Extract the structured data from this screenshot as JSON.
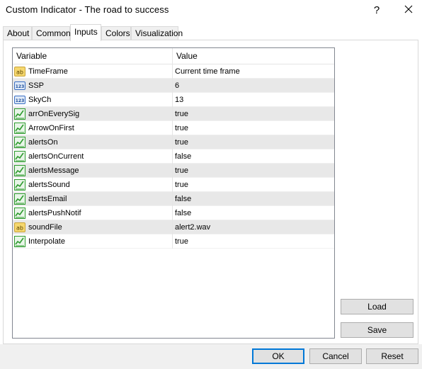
{
  "window": {
    "title": "Custom Indicator - The road to success",
    "help_glyph": "?",
    "close_glyph": "✕"
  },
  "tabs": [
    {
      "label": "About"
    },
    {
      "label": "Common"
    },
    {
      "label": "Inputs"
    },
    {
      "label": "Colors"
    },
    {
      "label": "Visualization"
    }
  ],
  "active_tab": "Inputs",
  "grid": {
    "columns": {
      "variable": "Variable",
      "value": "Value"
    },
    "rows": [
      {
        "icon": "string-icon",
        "variable": "TimeFrame",
        "value": "Current time frame"
      },
      {
        "icon": "number-icon",
        "variable": "SSP",
        "value": "6"
      },
      {
        "icon": "number-icon",
        "variable": "SkyCh",
        "value": "13"
      },
      {
        "icon": "bool-icon",
        "variable": "arrOnEverySig",
        "value": "true"
      },
      {
        "icon": "bool-icon",
        "variable": "ArrowOnFirst",
        "value": "true"
      },
      {
        "icon": "bool-icon",
        "variable": "alertsOn",
        "value": "true"
      },
      {
        "icon": "bool-icon",
        "variable": "alertsOnCurrent",
        "value": "false"
      },
      {
        "icon": "bool-icon",
        "variable": "alertsMessage",
        "value": "true"
      },
      {
        "icon": "bool-icon",
        "variable": "alertsSound",
        "value": "true"
      },
      {
        "icon": "bool-icon",
        "variable": "alertsEmail",
        "value": "false"
      },
      {
        "icon": "bool-icon",
        "variable": "alertsPushNotif",
        "value": "false"
      },
      {
        "icon": "string-icon",
        "variable": "soundFile",
        "value": "alert2.wav"
      },
      {
        "icon": "bool-icon",
        "variable": "Interpolate",
        "value": "true"
      }
    ]
  },
  "buttons": {
    "load": "Load",
    "save": "Save",
    "ok": "OK",
    "cancel": "Cancel",
    "reset": "Reset"
  },
  "colors": {
    "accent": "#0078d7",
    "row_alt": "#e8e8e8",
    "bool_icon_green": "#2e9b2e",
    "number_icon_blue": "#3a6fc4",
    "string_icon_yellow": "#f5d76e"
  }
}
